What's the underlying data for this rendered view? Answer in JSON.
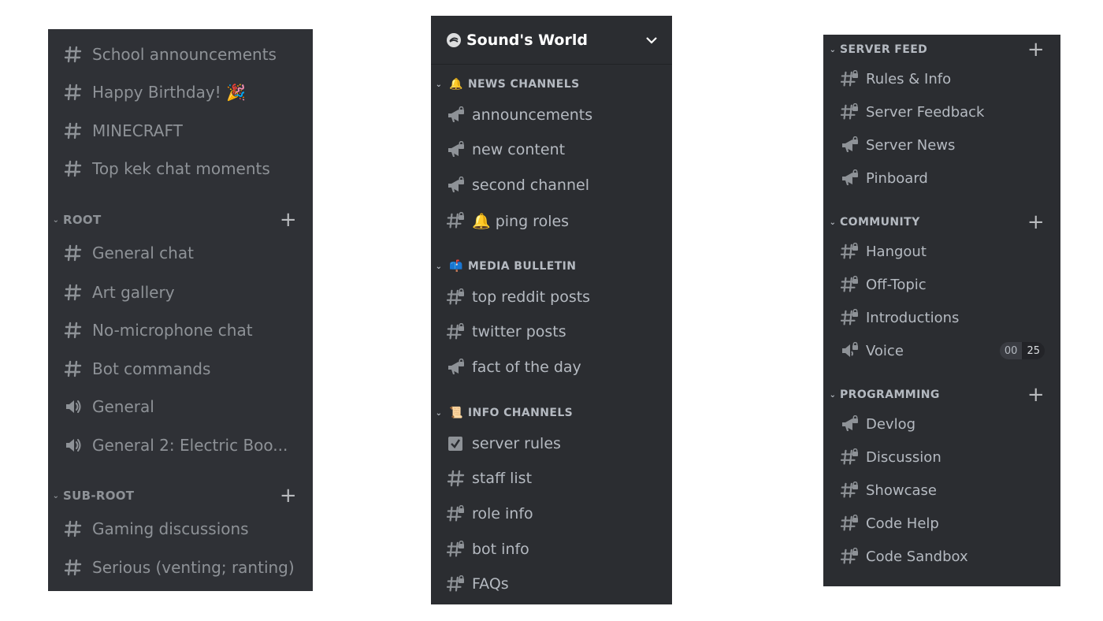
{
  "panel_left": {
    "top_channels": [
      {
        "label": "School announcements",
        "icon": "hash-icon"
      },
      {
        "label": "Happy Birthday! 🎉",
        "icon": "hash-icon"
      },
      {
        "label": "MINECRAFT",
        "icon": "hash-icon"
      },
      {
        "label": "Top kek chat moments",
        "icon": "hash-icon"
      }
    ],
    "categories": [
      {
        "name": "ROOT",
        "channels": [
          {
            "label": "General chat",
            "icon": "hash-icon"
          },
          {
            "label": "Art gallery",
            "icon": "hash-icon"
          },
          {
            "label": "No-microphone chat",
            "icon": "hash-icon"
          },
          {
            "label": "Bot commands",
            "icon": "hash-icon"
          },
          {
            "label": "General",
            "icon": "speaker-icon"
          },
          {
            "label": "General 2: Electric Boo...",
            "icon": "speaker-icon"
          }
        ]
      },
      {
        "name": "SUB-ROOT",
        "channels": [
          {
            "label": "Gaming discussions",
            "icon": "hash-icon"
          },
          {
            "label": "Serious (venting; ranting)",
            "icon": "hash-icon"
          }
        ]
      }
    ]
  },
  "panel_middle": {
    "server_name": "Sound's World",
    "categories": [
      {
        "name": "NEWS CHANNELS",
        "emoji": "🔔",
        "channels": [
          {
            "label": "announcements",
            "icon": "megaphone-lock-icon"
          },
          {
            "label": "new content",
            "icon": "megaphone-lock-icon"
          },
          {
            "label": "second channel",
            "icon": "megaphone-lock-icon"
          },
          {
            "label": "🔔 ping roles",
            "icon": "hash-lock-icon"
          }
        ]
      },
      {
        "name": "MEDIA BULLETIN",
        "emoji": "📫",
        "channels": [
          {
            "label": "top reddit posts",
            "icon": "hash-lock-icon"
          },
          {
            "label": "twitter posts",
            "icon": "hash-lock-icon"
          },
          {
            "label": "fact of the day",
            "icon": "megaphone-lock-icon"
          }
        ]
      },
      {
        "name": "INFO CHANNELS",
        "emoji": "📜",
        "channels": [
          {
            "label": "server rules",
            "icon": "rules-checkbox-icon"
          },
          {
            "label": "staff list",
            "icon": "hash-icon"
          },
          {
            "label": "role info",
            "icon": "hash-lock-icon"
          },
          {
            "label": "bot info",
            "icon": "hash-lock-icon"
          },
          {
            "label": "FAQs",
            "icon": "hash-lock-icon"
          }
        ]
      }
    ]
  },
  "panel_right": {
    "categories": [
      {
        "name": "SERVER FEED",
        "channels": [
          {
            "label": "Rules & Info",
            "icon": "hash-lock-icon"
          },
          {
            "label": "Server Feedback",
            "icon": "hash-lock-icon"
          },
          {
            "label": "Server News",
            "icon": "megaphone-lock-icon"
          },
          {
            "label": "Pinboard",
            "icon": "megaphone-lock-icon"
          }
        ]
      },
      {
        "name": "COMMUNITY",
        "channels": [
          {
            "label": "Hangout",
            "icon": "hash-lock-icon"
          },
          {
            "label": "Off-Topic",
            "icon": "hash-lock-icon"
          },
          {
            "label": "Introductions",
            "icon": "hash-lock-icon"
          },
          {
            "label": "Voice",
            "icon": "speaker-lock-icon"
          }
        ]
      },
      {
        "name": "PROGRAMMING",
        "channels": [
          {
            "label": "Devlog",
            "icon": "megaphone-lock-icon"
          },
          {
            "label": "Discussion",
            "icon": "hash-lock-icon"
          },
          {
            "label": "Showcase",
            "icon": "hash-lock-icon"
          },
          {
            "label": "Code Help",
            "icon": "hash-lock-icon"
          },
          {
            "label": "Code Sandbox",
            "icon": "hash-lock-icon"
          }
        ]
      }
    ],
    "voice_badge": {
      "connected": "00",
      "limit": "25"
    }
  },
  "colors": {
    "panel_bg": "#2f3136",
    "panel_bg_alt": "#2b2d31",
    "text_muted": "#8e9297",
    "text_channel": "#b5bac1"
  }
}
